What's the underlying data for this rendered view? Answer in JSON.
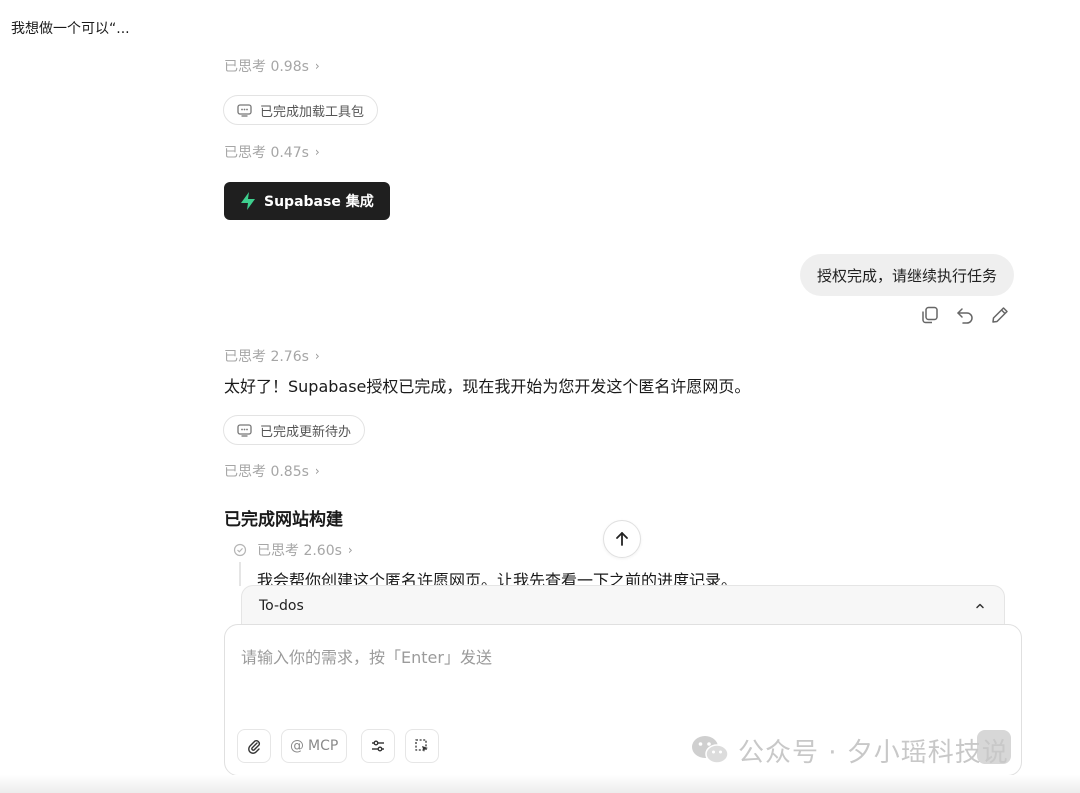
{
  "header": {
    "title": "我想做一个可以“..."
  },
  "thoughts": {
    "t1": "已思考 0.98s",
    "t2": "已思考 0.47s",
    "t3": "已思考 2.76s",
    "t4": "已思考 0.85s",
    "t5": "已思考 2.60s"
  },
  "pills": {
    "p1": "已完成加载工具包",
    "p2": "已完成更新待办"
  },
  "supabase_button": "Supabase 集成",
  "user_message": "授权完成，请继续执行任务",
  "assistant": {
    "reply": "太好了！Supabase授权已完成，现在我开始为您开发这个匿名许愿网页。",
    "section_title": "已完成网站构建",
    "step_text": "我会帮你创建这个匿名许愿网页。让我先查看一下之前的进度记录。"
  },
  "todos": {
    "label": "To-dos"
  },
  "composer": {
    "placeholder": "请输入你的需求，按「Enter」发送",
    "mcp_label": "MCP",
    "mcp_prefix": "@"
  },
  "watermark": {
    "text": "公众号 · 夕小瑶科技说"
  },
  "icons": {
    "pill": "monitor-chat-icon",
    "actions": [
      "copy-icon",
      "undo-icon",
      "edit-icon"
    ],
    "tools": [
      "paperclip-icon",
      "at-icon",
      "sliders-icon",
      "select-area-icon"
    ]
  },
  "colors": {
    "supabase_green": "#3ecf8e",
    "dark_button": "#1f1f1f",
    "bubble": "#efefef"
  }
}
